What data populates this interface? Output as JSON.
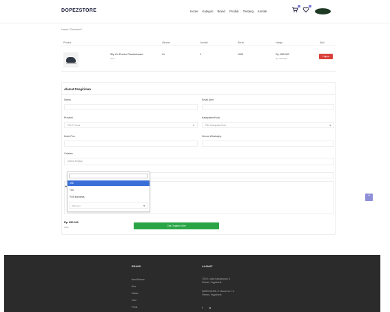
{
  "brand": "DOPEZSTORE",
  "nav": [
    "Home",
    "Kategori",
    "Brand",
    "Produk",
    "Tentang",
    "Kontak"
  ],
  "icons": {
    "cart": "cart-icon",
    "wishlist": "heart-icon",
    "user": "avatar"
  },
  "breadcrumb": "Home  /  Checkout  /",
  "table": {
    "headers": [
      "Produk",
      "Ukuran",
      "Jumlah",
      "Berat",
      "Harga",
      "Aksi"
    ],
    "row": {
      "name": "Slip On Pewter Checkerboard",
      "sub": "Vans",
      "size": "41",
      "qty": "1",
      "weight": "1000",
      "price": "Rp. 850.000",
      "price_sub": "Rp. 850.000",
      "delete_label": "Hapus"
    }
  },
  "form": {
    "title": "Alamat Pengiriman",
    "name_label": "Nama",
    "email_label": "Email Aktif",
    "province_label": "Provinsi",
    "province_placeholder": "Pilih Provinsi",
    "city_label": "Kabupaten/Kota",
    "city_placeholder": "Pilih Kabupaten/Kota",
    "postal_label": "Kode Pos",
    "whatsapp_label": "Nomor WhatsApp",
    "address_label": "Catatan",
    "address_placeholder": "Alamat lengkap"
  },
  "dropdown": {
    "options": [
      "JNE",
      "TIKI",
      "POS Indonesia"
    ],
    "selected_index": 0,
    "select_placeholder": "Pilih Kurir"
  },
  "payment_label": "Pe",
  "summary": {
    "total": "Rp. 850.000",
    "total_sub": "Total",
    "checkout_label": "Cek Ongkos Kirim"
  },
  "footer": {
    "col1_title": "BRAND",
    "col1_links": [
      "New Balance",
      "Nike",
      "Adidas",
      "Vans",
      "Puma"
    ],
    "col2_title": "ALAMAT",
    "address_lines": [
      "TOKO: Jalan Kaliurang km 5,",
      "Sleman, Yogyakarta",
      "WAREHOUSE: Jl. Mawar No. 12,",
      "Sleman, Yogyakarta"
    ],
    "social": [
      "f",
      "ig"
    ]
  },
  "colors": {
    "accent": "#3a6fd8",
    "danger": "#d9403a",
    "success": "#2aa546",
    "footer": "#2b2b2b",
    "brand": "#1b1b3a"
  }
}
